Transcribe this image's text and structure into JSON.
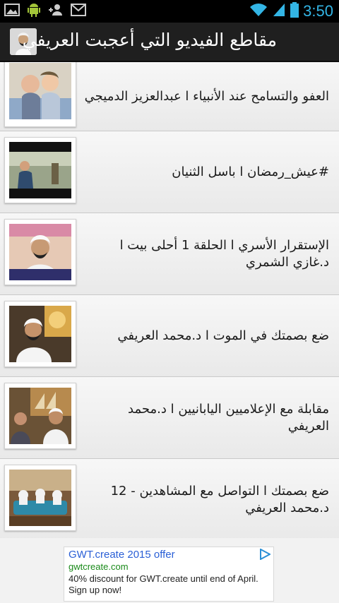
{
  "status_bar": {
    "time": "3:50",
    "icons": [
      "gallery-icon",
      "android-icon",
      "person-add-icon",
      "gmail-icon",
      "wifi-icon",
      "signal-icon",
      "battery-icon"
    ]
  },
  "action_bar": {
    "title": "مقاطع الفيديو التي أعجبت العريفي",
    "icon": "app-icon"
  },
  "videos": [
    {
      "title": "العفو والتسامح عند الأنبياء ا عبدالعزيز الدميجي"
    },
    {
      "title": "#عيش_رمضان ا باسل الثنيان"
    },
    {
      "title": "الإستقرار الأسري ا الحلقة 1 أحلى بيت ا د.غازي الشمري"
    },
    {
      "title": "ضع بصمتك في الموت ا د.محمد العريفي"
    },
    {
      "title": "مقابلة مع الإعلاميين اليابانيين ا د.محمد العريفي"
    },
    {
      "title": "ضع بصمتك ا التواصل مع المشاهدين - 12 د.محمد العريفي"
    }
  ],
  "ad": {
    "headline": "GWT.create 2015 offer",
    "url": "gwtcreate.com",
    "body": "40% discount for GWT.create until end of April. Sign up now!",
    "choices_icon": "ad-choices-icon"
  },
  "colors": {
    "status_bar_bg": "#000000",
    "clock": "#33b5e5",
    "action_bar_bg": "#1f1f1f",
    "list_bg": "#efefef",
    "ad_link": "#2a5fd6",
    "ad_url": "#1a8a1a"
  }
}
